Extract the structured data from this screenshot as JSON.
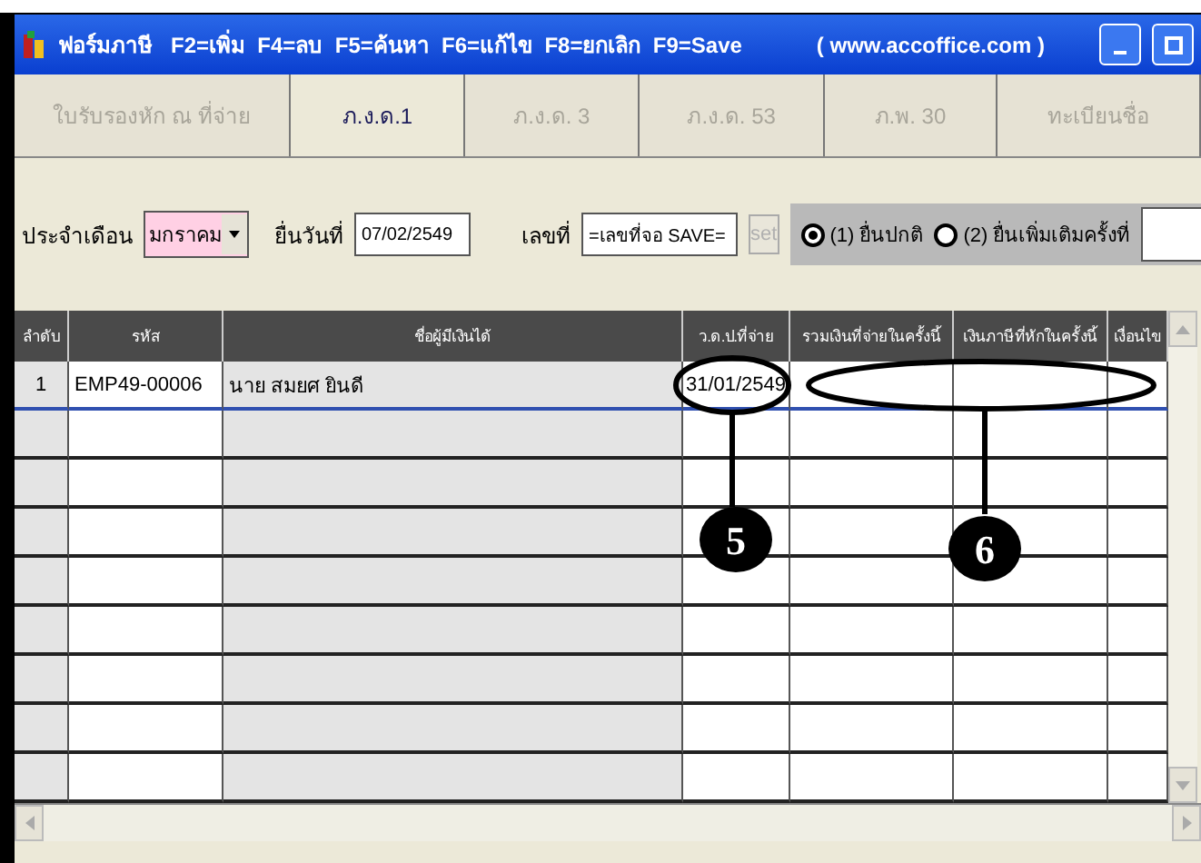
{
  "window": {
    "title": "ฟอร์มภาษี   F2=เพิ่ม  F4=ลบ  F5=ค้นหา  F6=แก้ไข  F8=ยกเลิก  F9=Save",
    "url": "( www.accoffice.com )"
  },
  "tabs": [
    {
      "label": "ใบรับรองหัก ณ ที่จ่าย",
      "selected": false
    },
    {
      "label": "ภ.ง.ด.1",
      "selected": true
    },
    {
      "label": "ภ.ง.ด. 3",
      "selected": false
    },
    {
      "label": "ภ.ง.ด. 53",
      "selected": false
    },
    {
      "label": "ภ.พ. 30",
      "selected": false
    },
    {
      "label": "ทะเบียนชื่อ",
      "selected": false
    }
  ],
  "form": {
    "month_label": "ประจำเดือน",
    "month": "มกราคม",
    "date_label": "ยื่นวันที่",
    "date": "07/02/2549",
    "number_label": "เลขที่",
    "number": "=เลขที่จอ SAVE=",
    "set_button": {
      "label": "set",
      "disabled": true
    },
    "radios": [
      {
        "label": "(1) ยื่นปกติ",
        "selected": true
      },
      {
        "label": "(2) ยื่นเพิ่มเติมครั้งที่",
        "selected": false
      }
    ]
  },
  "table": {
    "columns": [
      "ลำดับ",
      "รหัส",
      "ชื่อผู้มีเงินได้",
      "ว.ด.ป.ที่จ่าย",
      "รวมเงินที่จ่ายในครั้งนี้",
      "เงินภาษีที่หักในครั้งนี้",
      "เงื่อนไข"
    ],
    "rows": [
      {
        "cells": [
          "1",
          "EMP49-00006",
          "นาย  สมยศ ยินดี",
          "31/01/2549"
        ],
        "selected": true
      }
    ]
  },
  "annotations": [
    {
      "label": "5"
    },
    {
      "label": "6"
    }
  ]
}
